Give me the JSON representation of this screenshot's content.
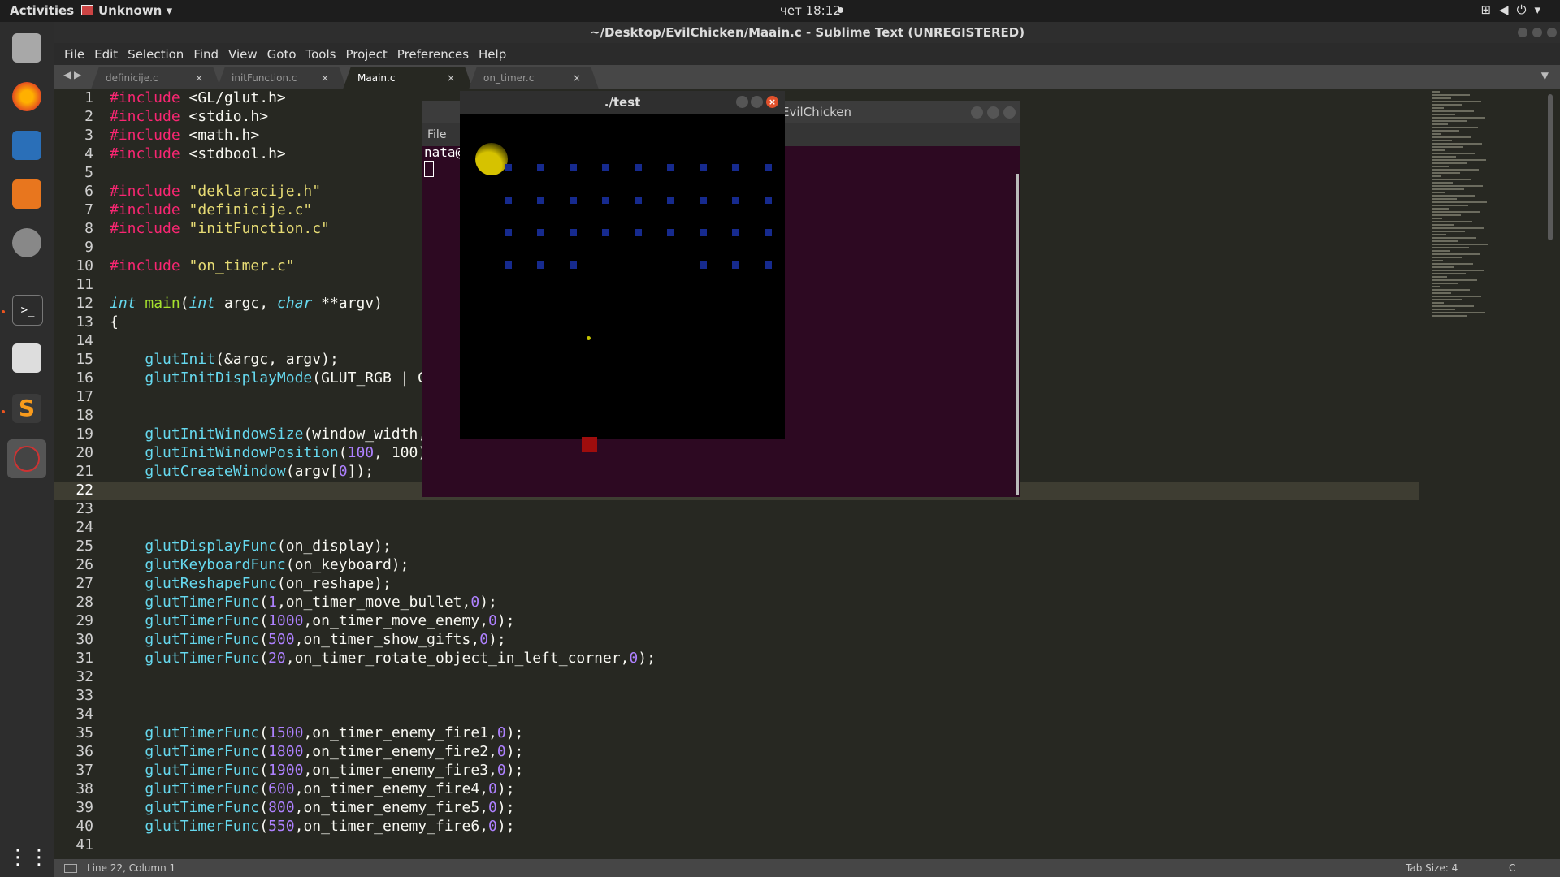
{
  "topbar": {
    "activities": "Activities",
    "app_menu": "Unknown",
    "clock": "чет 18:12"
  },
  "window": {
    "title": "~/Desktop/EvilChicken/Maain.c - Sublime Text (UNREGISTERED)"
  },
  "menu": [
    "File",
    "Edit",
    "Selection",
    "Find",
    "View",
    "Goto",
    "Tools",
    "Project",
    "Preferences",
    "Help"
  ],
  "tabs": [
    {
      "label": "definicije.c",
      "close": "×"
    },
    {
      "label": "initFunction.c",
      "close": "×"
    },
    {
      "label": "Maain.c",
      "close": "×",
      "active": true
    },
    {
      "label": "on_timer.c",
      "close": "×"
    }
  ],
  "editor": {
    "current_line": 22,
    "lines": [
      "#include <GL/glut.h>",
      "#include <stdio.h>",
      "#include <math.h>",
      "#include <stdbool.h>",
      "",
      "#include \"deklaracije.h\"",
      "#include \"definicije.c\"",
      "#include \"initFunction.c\"",
      "",
      "#include \"on_timer.c\"",
      "",
      "int main(int argc, char **argv)",
      "{",
      "",
      "    glutInit(&argc, argv);",
      "    glutInitDisplayMode(GLUT_RGB | GLUT_DEPTH | GLUT_DOUBLE);",
      "",
      "",
      "    glutInitWindowSize(window_width, window_height);",
      "    glutInitWindowPosition(100, 100);",
      "    glutCreateWindow(argv[0]);",
      "",
      "",
      "",
      "    glutDisplayFunc(on_display);",
      "    glutKeyboardFunc(on_keyboard);",
      "    glutReshapeFunc(on_reshape);",
      "    glutTimerFunc(1,on_timer_move_bullet,0);",
      "    glutTimerFunc(1000,on_timer_move_enemy,0);",
      "    glutTimerFunc(500,on_timer_show_gifts,0);",
      "    glutTimerFunc(20,on_timer_rotate_object_in_left_corner,0);",
      "",
      "",
      "",
      "    glutTimerFunc(1500,on_timer_enemy_fire1,0);",
      "    glutTimerFunc(1800,on_timer_enemy_fire2,0);",
      "    glutTimerFunc(1900,on_timer_enemy_fire3,0);",
      "    glutTimerFunc(600,on_timer_enemy_fire4,0);",
      "    glutTimerFunc(800,on_timer_enemy_fire5,0);",
      "    glutTimerFunc(550,on_timer_enemy_fire6,0);",
      ""
    ]
  },
  "terminal": {
    "title": "EvilChicken",
    "menu_file": "File",
    "prompt": "nata@"
  },
  "test_window": {
    "title": "./test",
    "enemy_rows": [
      [
        1,
        1,
        1,
        1,
        1,
        1,
        1,
        1,
        1
      ],
      [
        1,
        1,
        1,
        1,
        1,
        1,
        1,
        1,
        1
      ],
      [
        1,
        1,
        1,
        1,
        1,
        1,
        1,
        1,
        1
      ],
      [
        1,
        1,
        1,
        0,
        0,
        0,
        1,
        1,
        1
      ]
    ],
    "colors": {
      "enemy": "#162a8e",
      "player": "#9e0d0d",
      "moon": "#d6c200",
      "bullet": "#c4c400"
    }
  },
  "statusbar": {
    "position": "Line 22, Column 1",
    "tab_size": "Tab Size: 4",
    "syntax": "C"
  },
  "colors": {
    "editor_bg": "#272822",
    "keyword": "#f92672",
    "string": "#e6db74",
    "function": "#66d9ef",
    "number": "#ae81ff"
  }
}
